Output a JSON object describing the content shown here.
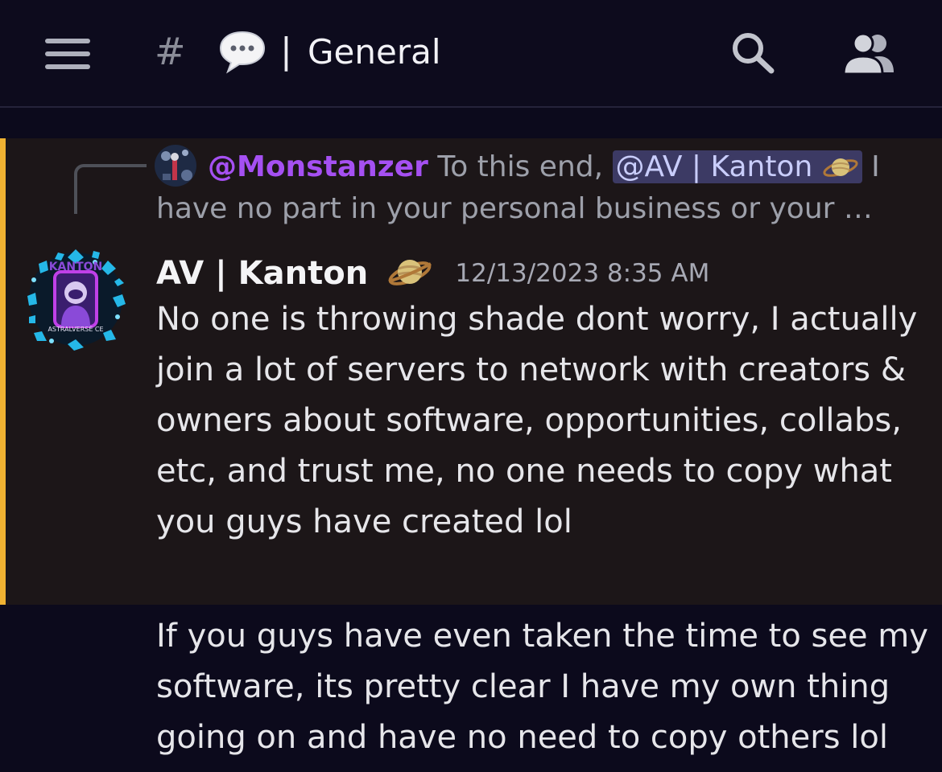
{
  "header": {
    "channel_prefix": "#",
    "separator": "|",
    "channel_name": "General",
    "icons": [
      "menu-icon",
      "speech-bubble-icon",
      "search-icon",
      "members-icon"
    ]
  },
  "reply": {
    "author": "@Monstanzer",
    "text_before": " To this end, ",
    "mention": "@AV | Kanton",
    "text_after": " I have no part in your personal business or your …"
  },
  "message": {
    "author": "AV | Kanton",
    "badge_icon": "saturn-icon",
    "timestamp": "12/13/2023 8:35 AM",
    "avatar_text_top": "KANTON",
    "avatar_text_bottom": "ASTRALVERSE CE",
    "body": "No one is throwing shade dont worry, I actually join a lot of servers to network with creators & owners about software, opportunities, collabs, etc, and trust me, no one needs to copy what you guys have created lol",
    "followup": "If you guys have even taken the time to see my software, its pretty clear I have my own thing going on and have no need to copy others lol"
  },
  "colors": {
    "background": "#0c0a1c",
    "highlight_bg": "#1c1618",
    "highlight_accent": "#f0b232",
    "reply_author": "#a550f2",
    "mention_bg": "#3c3a64"
  }
}
